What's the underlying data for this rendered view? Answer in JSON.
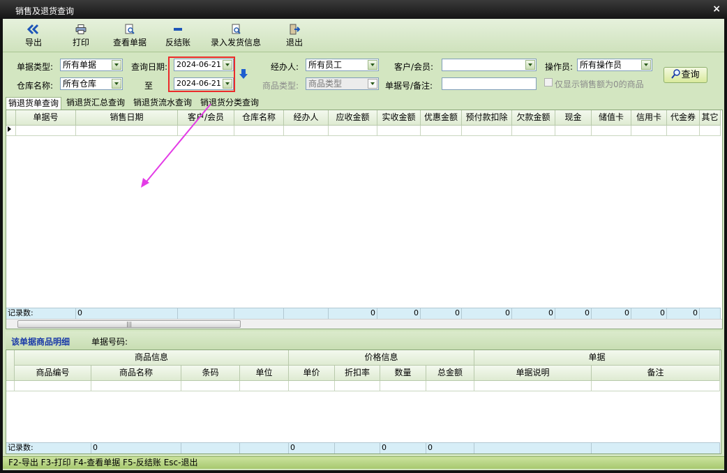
{
  "window": {
    "title": "销售及退货查询",
    "close_glyph": "×"
  },
  "toolbar": {
    "export": {
      "label": "导出",
      "icon": "double-chevron-left-icon"
    },
    "print": {
      "label": "打印",
      "icon": "printer-icon"
    },
    "view": {
      "label": "查看单据",
      "icon": "document-search-icon"
    },
    "reverse": {
      "label": "反结账",
      "icon": "minus-icon"
    },
    "shipping": {
      "label": "录入发货信息",
      "icon": "document-edit-icon"
    },
    "exit": {
      "label": "退出",
      "icon": "exit-door-icon"
    }
  },
  "filters": {
    "doc_type_label": "单据类型:",
    "doc_type_value": "所有单据",
    "date_label": "查询日期:",
    "date_from": "2024-06-21",
    "to_label": "至",
    "date_to": "2024-06-21",
    "handler_label": "经办人:",
    "handler_value": "所有员工",
    "customer_label": "客户/会员:",
    "customer_value": "",
    "operator_label": "操作员:",
    "operator_value": "所有操作员",
    "warehouse_label": "仓库名称:",
    "warehouse_value": "所有仓库",
    "category_label": "商品类型:",
    "category_value": "商品类型",
    "docno_label": "单据号/备注:",
    "docno_value": "",
    "zero_checkbox_label": "仅显示销售额为0的商品",
    "query_button": "查询"
  },
  "tabs": [
    "销退货单查询",
    "销退货汇总查询",
    "销退货流水查询",
    "销退货分类查询"
  ],
  "main_grid": {
    "columns": [
      "单据号",
      "销售日期",
      "客户/会员",
      "仓库名称",
      "经办人",
      "应收金额",
      "实收金额",
      "优惠金额",
      "预付款扣除",
      "欠款金额",
      "现金",
      "储值卡",
      "信用卡",
      "代金券",
      "其它"
    ],
    "footer_label": "记录数:",
    "footer_values": [
      "0",
      "",
      "",
      "",
      "0",
      "0",
      "0",
      "0",
      "0",
      "0",
      "0",
      "0",
      "0"
    ],
    "scroll_grip": "|||"
  },
  "detail": {
    "title": "该单据商品明细",
    "docno_label": "单据号码:",
    "groups": [
      "商品信息",
      "价格信息",
      "单据"
    ],
    "columns": [
      "商品编号",
      "商品名称",
      "条码",
      "单位",
      "单价",
      "折扣率",
      "数量",
      "总金额",
      "单据说明",
      "备注"
    ],
    "footer_label": "记录数:",
    "footer_values": [
      "0",
      "",
      "",
      "0",
      "",
      "0",
      "0",
      "",
      ""
    ]
  },
  "statusbar": "F2-导出 F3-打印 F4-查看单据 F5-反结账 Esc-退出",
  "colors": {
    "accent_red": "#ec2a2a",
    "annotation_magenta": "#e33ce6",
    "query_blue": "#1a3aa8"
  }
}
